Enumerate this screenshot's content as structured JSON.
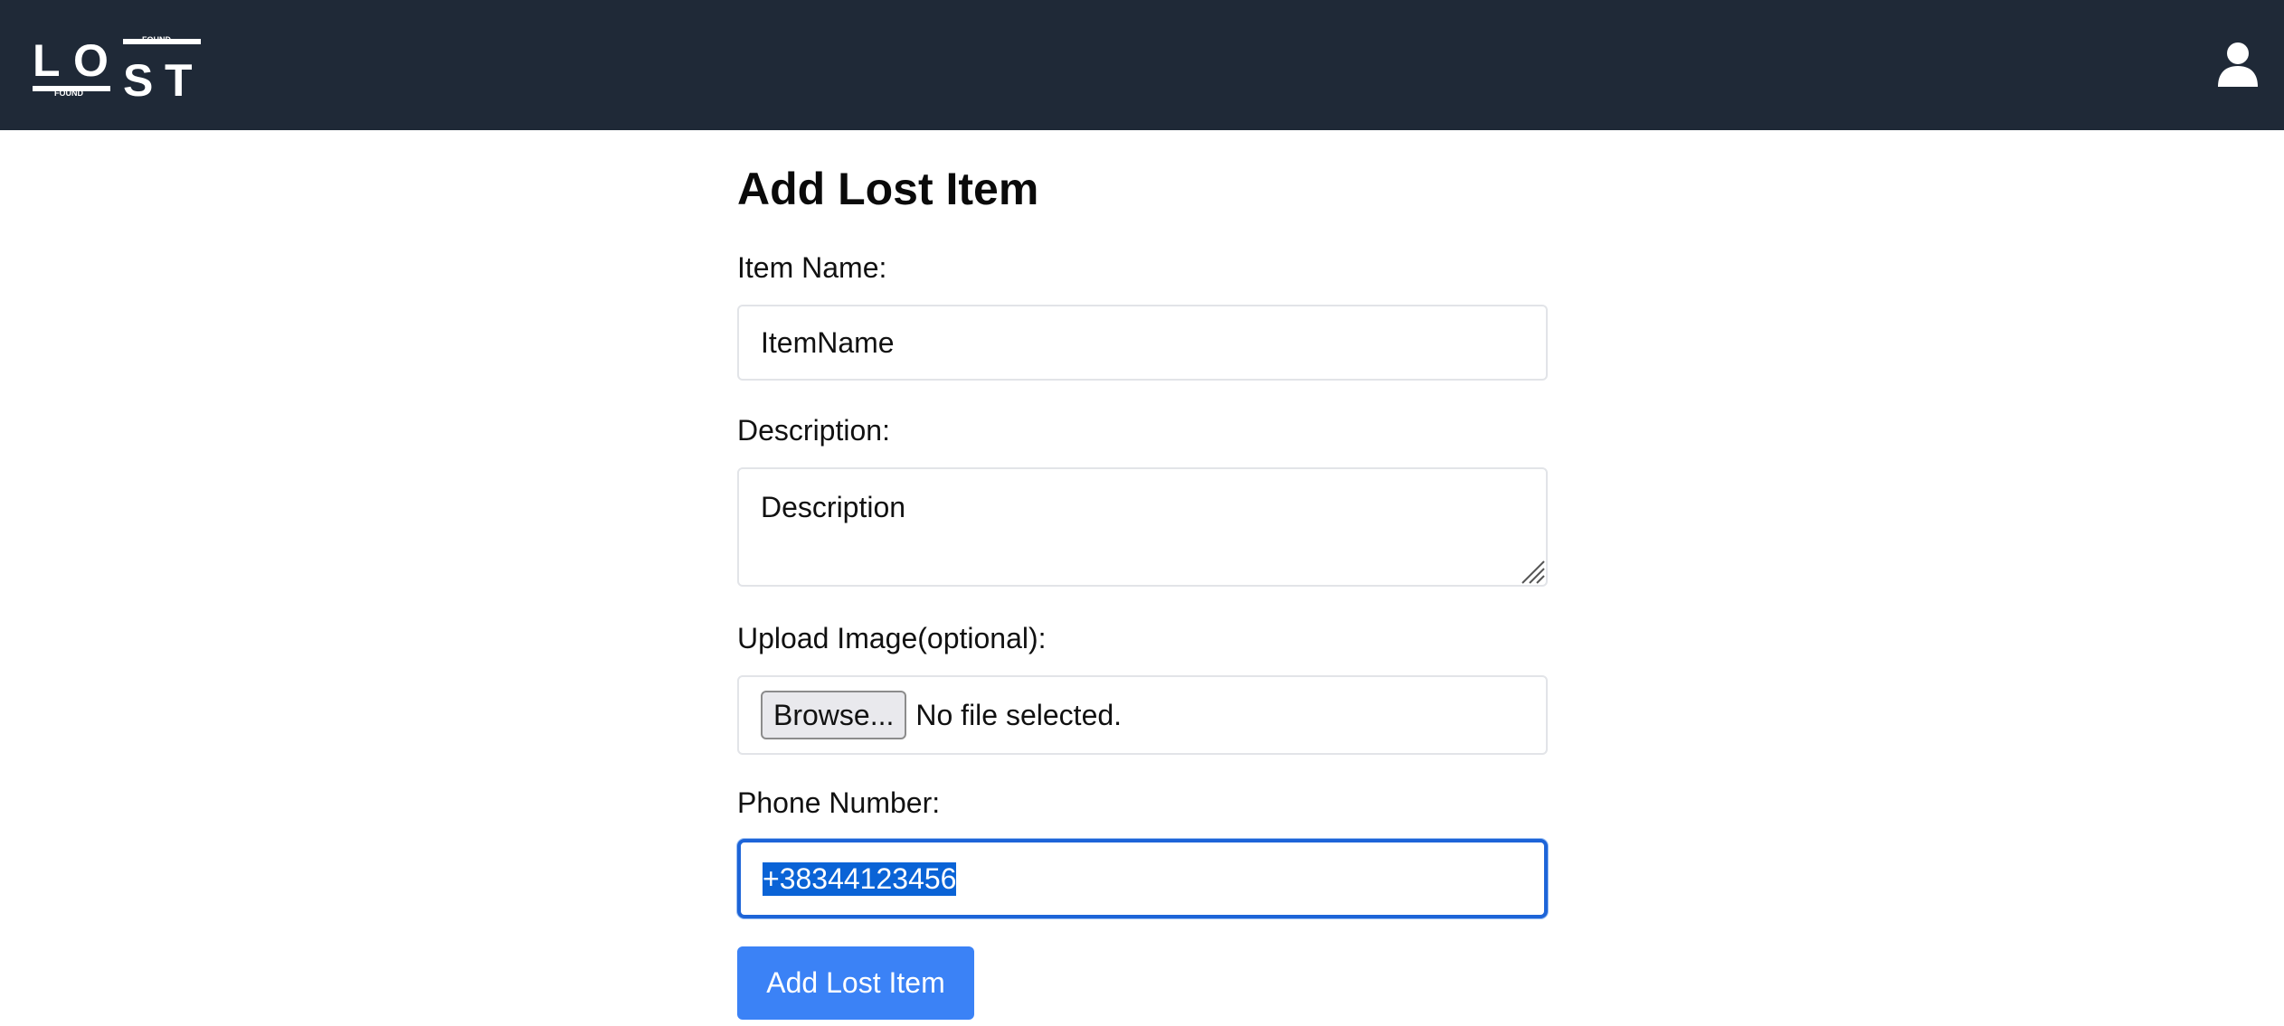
{
  "header": {
    "logo": {
      "main_text": "LOST",
      "tag_top": "FOUND",
      "tag_bottom": "FOUND"
    },
    "user_icon": "user-icon"
  },
  "page_title": "Add Lost Item",
  "form": {
    "item_name": {
      "label": "Item Name:",
      "value": "ItemName"
    },
    "description": {
      "label": "Description:",
      "value": "Description"
    },
    "upload": {
      "label": "Upload Image(optional):",
      "button_label": "Browse...",
      "status": "No file selected."
    },
    "phone": {
      "label": "Phone Number:",
      "value": "+38344123456"
    },
    "submit_label": "Add Lost Item"
  },
  "colors": {
    "navbar": "#1f2937",
    "primary": "#3b82f6",
    "focus_ring": "#1d64d8",
    "selection": "#0a63d6"
  }
}
